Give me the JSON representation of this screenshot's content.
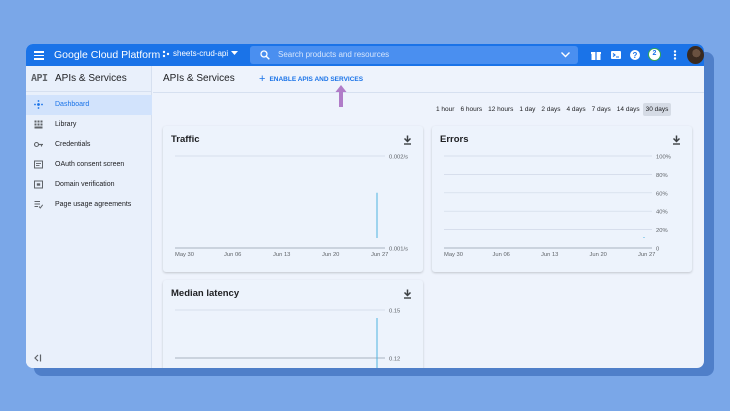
{
  "topbar": {
    "brand": "Google Cloud Platform",
    "project": "sheets-crud-api",
    "search_placeholder": "Search products and resources",
    "notification_count": "2",
    "accent": "#1a73e8"
  },
  "sidebar": {
    "logo": "API",
    "title": "APIs & Services",
    "items": [
      {
        "label": "Dashboard",
        "icon": "dashboard-icon",
        "active": true
      },
      {
        "label": "Library",
        "icon": "library-icon",
        "active": false
      },
      {
        "label": "Credentials",
        "icon": "key-icon",
        "active": false
      },
      {
        "label": "OAuth consent screen",
        "icon": "consent-icon",
        "active": false
      },
      {
        "label": "Domain verification",
        "icon": "domain-icon",
        "active": false
      },
      {
        "label": "Page usage agreements",
        "icon": "agreements-icon",
        "active": false
      }
    ]
  },
  "main": {
    "title": "APIs & Services",
    "enable_button": "ENABLE APIS AND SERVICES",
    "annotation_color": "#b07cc8",
    "ranges": [
      "1 hour",
      "6 hours",
      "12 hours",
      "1 day",
      "2 days",
      "4 days",
      "7 days",
      "14 days",
      "30 days"
    ],
    "selected_range": "30 days"
  },
  "chart_data": [
    {
      "type": "line",
      "title": "Traffic",
      "x": [
        "May 30",
        "Jun 06",
        "Jun 13",
        "Jun 20",
        "Jun 27"
      ],
      "y_ticks": [
        "0.002/s",
        "0.001/s"
      ],
      "spike": {
        "at": "Jun 27",
        "value": 0.0016
      },
      "ylim": [
        0.001,
        0.002
      ]
    },
    {
      "type": "line",
      "title": "Errors",
      "x": [
        "May 30",
        "Jun 06",
        "Jun 13",
        "Jun 20",
        "Jun 27"
      ],
      "y_ticks": [
        "100%",
        "80%",
        "60%",
        "40%",
        "20%",
        "0"
      ],
      "spike": {
        "at": "Jun 27",
        "value": 12
      },
      "ylim": [
        0,
        100
      ]
    },
    {
      "type": "line",
      "title": "Median latency",
      "x": [],
      "y_ticks": [
        "0.15",
        "0.12"
      ],
      "ylim": [
        0.12,
        0.15
      ]
    }
  ]
}
